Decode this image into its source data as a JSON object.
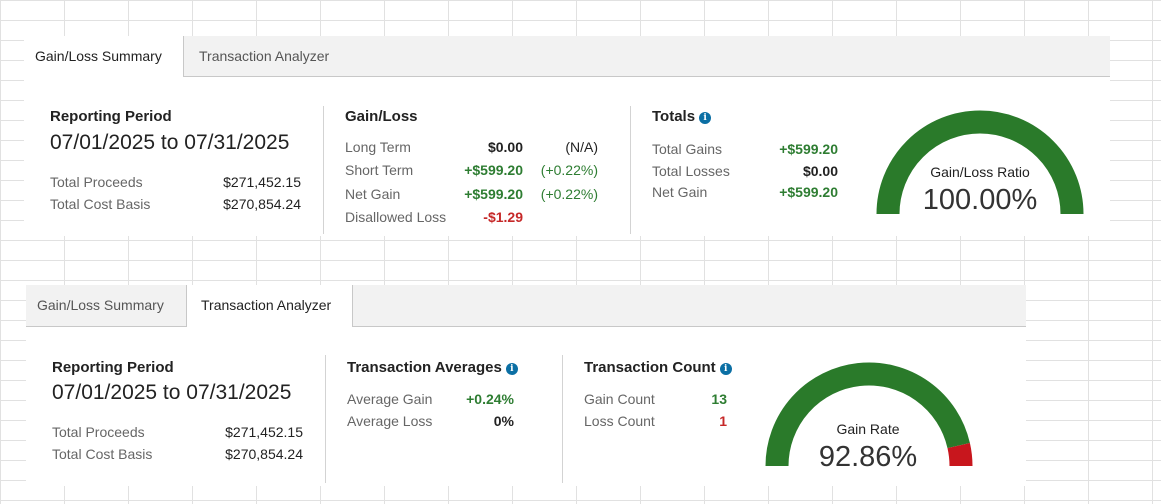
{
  "panels": [
    {
      "tabs": [
        {
          "label": "Gain/Loss Summary",
          "active": true
        },
        {
          "label": "Transaction Analyzer",
          "active": false
        }
      ],
      "reporting": {
        "title": "Reporting Period",
        "dates": "07/01/2025 to 07/31/2025",
        "rows": [
          {
            "label": "Total Proceeds",
            "value": "$271,452.15"
          },
          {
            "label": "Total Cost Basis",
            "value": "$270,854.24"
          }
        ]
      },
      "gainloss": {
        "title": "Gain/Loss",
        "rows": [
          {
            "label": "Long Term",
            "value": "$0.00",
            "pct": "(N/A)"
          },
          {
            "label": "Short Term",
            "value": "+$599.20",
            "pct": "(+0.22%)"
          },
          {
            "label": "Net Gain",
            "value": "+$599.20",
            "pct": "(+0.22%)"
          },
          {
            "label": "Disallowed Loss",
            "value": "-$1.29",
            "pct": ""
          }
        ]
      },
      "totals": {
        "title": "Totals",
        "info_icon": "info-icon",
        "rows": [
          {
            "label": "Total Gains",
            "value": "+$599.20"
          },
          {
            "label": "Total Losses",
            "value": "$0.00"
          },
          {
            "label": "Net Gain",
            "value": "+$599.20"
          }
        ]
      },
      "gauge": {
        "title": "Gain/Loss Ratio",
        "value": "100.00%",
        "fraction": 1.0,
        "color_positive": "#2a7a2a",
        "color_negative": "#c8161d"
      }
    },
    {
      "tabs": [
        {
          "label": "Gain/Loss Summary",
          "active": false
        },
        {
          "label": "Transaction Analyzer",
          "active": true
        }
      ],
      "reporting": {
        "title": "Reporting Period",
        "dates": "07/01/2025 to 07/31/2025",
        "rows": [
          {
            "label": "Total Proceeds",
            "value": "$271,452.15"
          },
          {
            "label": "Total Cost Basis",
            "value": "$270,854.24"
          }
        ]
      },
      "averages": {
        "title": "Transaction Averages",
        "info_icon": "info-icon",
        "rows": [
          {
            "label": "Average Gain",
            "value": "+0.24%"
          },
          {
            "label": "Average Loss",
            "value": "0%"
          }
        ]
      },
      "count": {
        "title": "Transaction Count",
        "info_icon": "info-icon",
        "rows": [
          {
            "label": "Gain Count",
            "value": "13"
          },
          {
            "label": "Loss Count",
            "value": "1"
          }
        ]
      },
      "gauge": {
        "title": "Gain Rate",
        "value": "92.86%",
        "fraction": 0.9286,
        "color_positive": "#2a7a2a",
        "color_negative": "#c8161d"
      }
    }
  ]
}
